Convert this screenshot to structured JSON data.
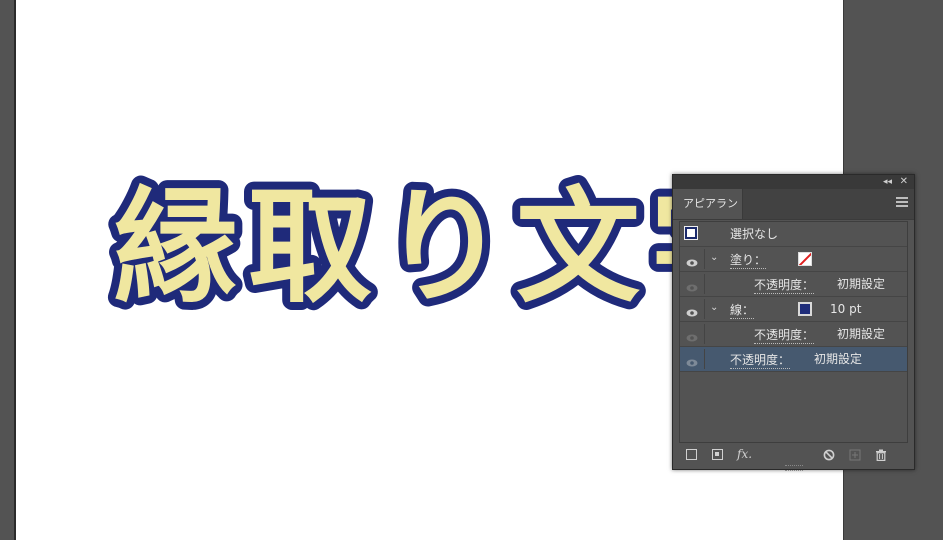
{
  "artboard": {
    "text": "縁取り文字",
    "fill_color": "#f0e7a0",
    "stroke_color": "#1f2a7a"
  },
  "panel": {
    "tab_label": "アピアランス",
    "collapse_glyph": "◂◂",
    "close_glyph": "✕",
    "object_row": {
      "label": "選択なし"
    },
    "fill_row": {
      "label": "塗り："
    },
    "fill_opacity_row": {
      "label": "不透明度：",
      "value": "初期設定"
    },
    "stroke_row": {
      "label": "線：",
      "value": "10 pt"
    },
    "stroke_opacity_row": {
      "label": "不透明度：",
      "value": "初期設定"
    },
    "opacity_row": {
      "label": "不透明度：",
      "value": "初期設定"
    },
    "bottom_toolbar": {
      "fx_label": "fx.",
      "icons": [
        "add-new-stroke-icon",
        "add-new-fill-icon",
        "fx-icon",
        "clear-appearance-icon",
        "duplicate-item-icon",
        "trash-icon"
      ]
    }
  },
  "colors": {
    "panel_bg": "#535353",
    "selected_row": "#46596f",
    "accent_red": "#e02020",
    "stroke_swatch": "#1f2d7a"
  }
}
